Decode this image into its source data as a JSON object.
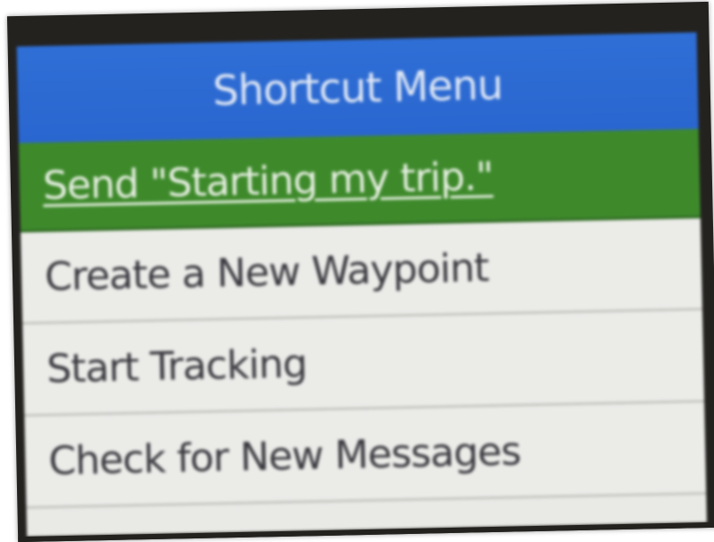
{
  "header": {
    "title": "Shortcut Menu"
  },
  "menu": {
    "items": [
      {
        "label": "Send \"Starting my trip.\"",
        "selected": true
      },
      {
        "label": "Create a New Waypoint",
        "selected": false
      },
      {
        "label": "Start Tracking",
        "selected": false
      },
      {
        "label": "Check for New Messages",
        "selected": false
      }
    ]
  },
  "colors": {
    "header_bg": "#2f6fd6",
    "selected_bg": "#3e8a2b",
    "item_bg": "#ebebe8",
    "text": "#3a3a40"
  }
}
